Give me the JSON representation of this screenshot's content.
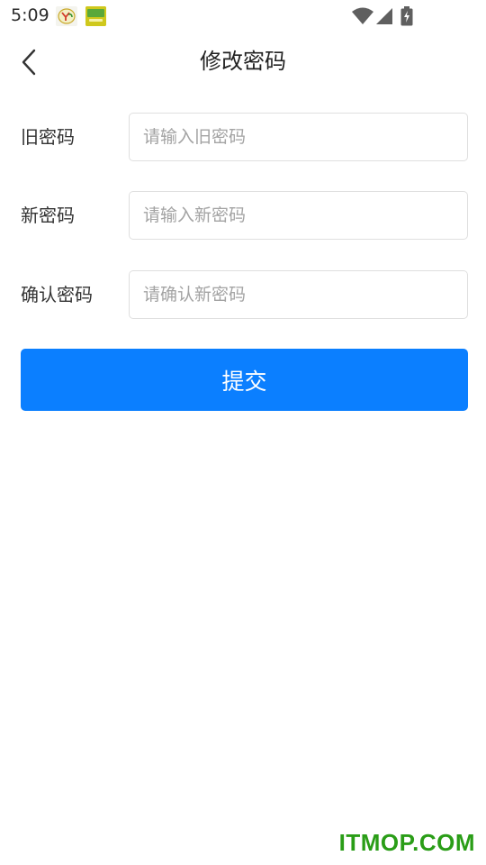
{
  "status_bar": {
    "time": "5:09",
    "icons": [
      "app-notification-icon",
      "app-notification-icon-2",
      "wifi-icon",
      "signal-icon",
      "battery-charging-icon"
    ]
  },
  "header": {
    "back_icon": "chevron-left-icon",
    "title": "修改密码"
  },
  "form": {
    "old_password": {
      "label": "旧密码",
      "placeholder": "请输入旧密码",
      "value": ""
    },
    "new_password": {
      "label": "新密码",
      "placeholder": "请输入新密码",
      "value": ""
    },
    "confirm_password": {
      "label": "确认密码",
      "placeholder": "请确认新密码",
      "value": ""
    }
  },
  "submit": {
    "label": "提交"
  },
  "watermark": {
    "text": "ITMOP.COM"
  },
  "colors": {
    "accent": "#0b7fff",
    "watermark": "#2a9d17",
    "input_border": "#dfdfdf",
    "placeholder": "#a3a3a3"
  }
}
